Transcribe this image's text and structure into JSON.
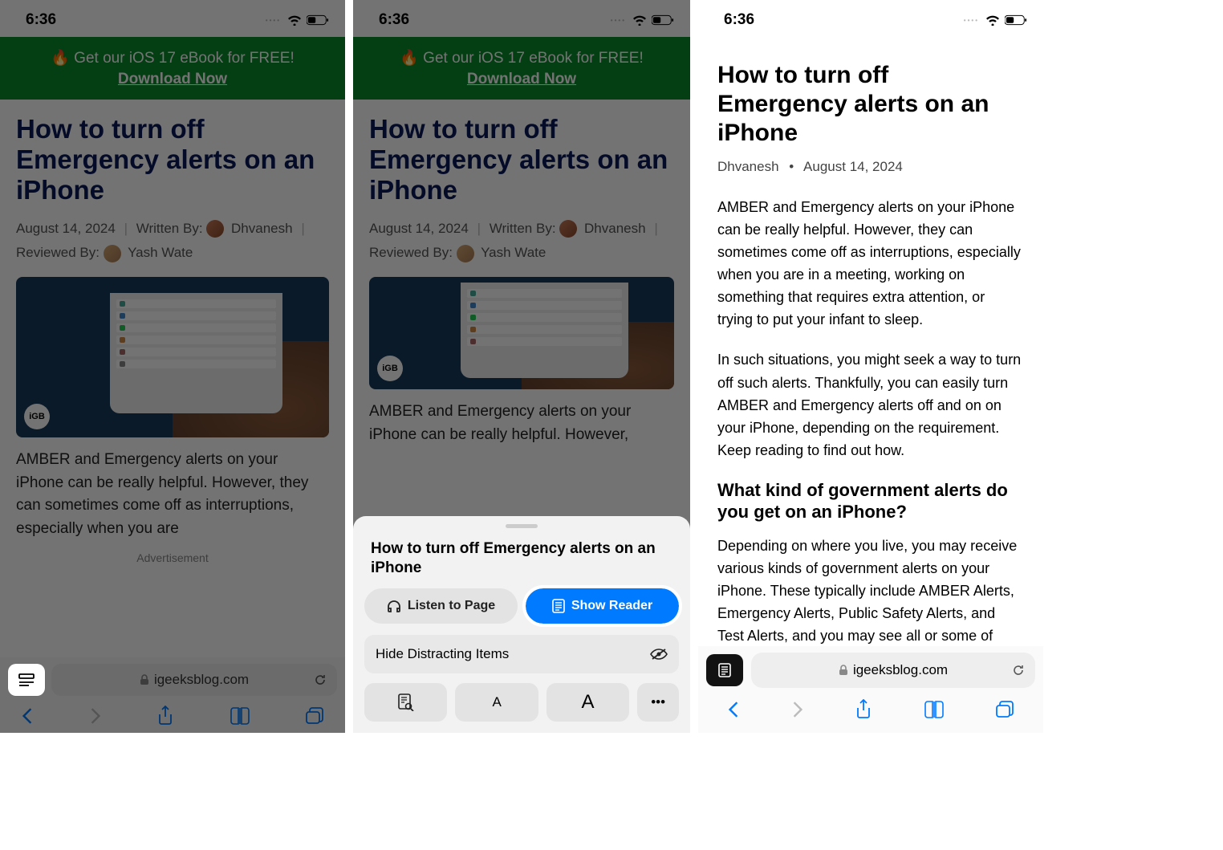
{
  "status": {
    "time": "6:36",
    "battery": "40"
  },
  "banner": {
    "line1": "🔥 Get our iOS 17 eBook for FREE!",
    "line2": "Download Now"
  },
  "article": {
    "title": "How to turn off Emergency alerts on an iPhone",
    "date": "August 14, 2024",
    "written_label": "Written By:",
    "author": "Dhvanesh",
    "reviewed_label": "Reviewed By:",
    "reviewer": "Yash Wate",
    "hero_badge": "iGB",
    "intro_p1": "AMBER and Emergency alerts on your iPhone can be really helpful. However, they can sometimes come off as interruptions, especially when you are",
    "intro_p2": "AMBER and Emergency alerts on your iPhone can be really helpful. However,",
    "ad_label": "Advertisement"
  },
  "sheet": {
    "title": "How to turn off Emergency alerts on an iPhone",
    "listen": "Listen to Page",
    "show_reader": "Show Reader",
    "hide_distracting": "Hide Distracting Items"
  },
  "url": {
    "domain": "igeeksblog.com"
  },
  "reader": {
    "title": "How to turn off Emergency alerts on an iPhone",
    "author": "Dhvanesh",
    "date": "August 14, 2024",
    "p1": "AMBER and Emergency alerts on your iPhone can be really helpful. However, they can sometimes come off as interruptions, especially when you are in a meeting, working on something that requires extra attention, or trying to put your infant to sleep.",
    "p2": "In such situations, you might seek a way to turn off such alerts. Thankfully, you can easily turn AMBER and Emergency alerts off and on on your iPhone, depending on the requirement. Keep reading to find out how.",
    "h2": "What kind of government alerts do you get on an iPhone?",
    "p3": "Depending on where you live, you may receive various kinds of government alerts on your iPhone. These typically include AMBER Alerts, Emergency Alerts, Public Safety Alerts, and Test Alerts, and you may see all or some of them based on your country. Let's look at what each"
  },
  "font_controls": {
    "small": "A",
    "large": "A",
    "more": "•••"
  }
}
